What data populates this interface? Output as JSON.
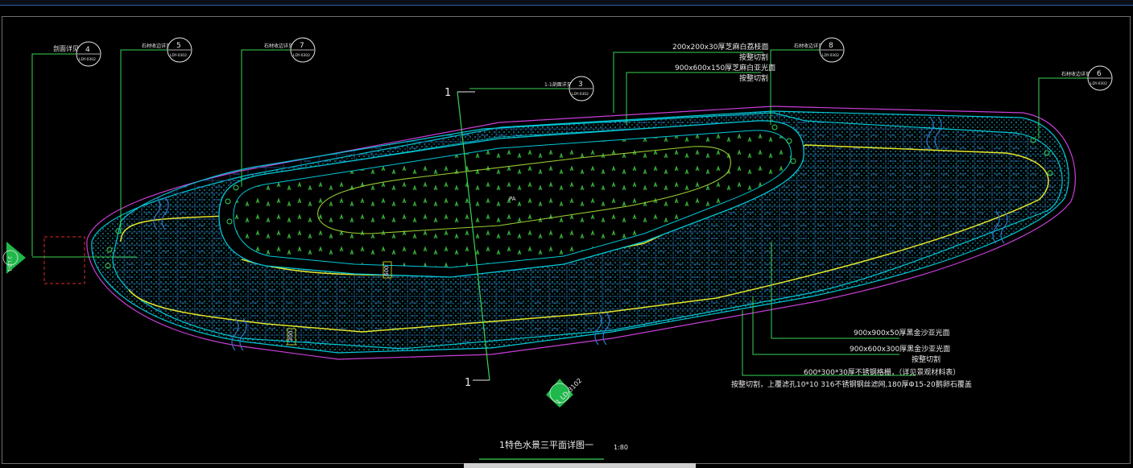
{
  "drawing": {
    "title": "1特色水景三平面详图一",
    "scale": "1:80",
    "area_label": "PA",
    "section_marker_top": "1",
    "section_marker_bottom": "1",
    "dim_600": "600",
    "dim_300": "300",
    "left_symbol": "2\nLD-1",
    "bottom_symbol": "1\nLD-3102"
  },
  "callouts": [
    {
      "id": "c4",
      "text": "剖面详见",
      "num": "4",
      "ref": "LDY-0302"
    },
    {
      "id": "c5",
      "text": "石材收边详见",
      "num": "5",
      "ref": "LDY-0302"
    },
    {
      "id": "c7",
      "text": "石材收边详见",
      "num": "7",
      "ref": "LDY-0302"
    },
    {
      "id": "c3",
      "text": "1-1剖面详见",
      "num": "3",
      "ref": "LDY-0302"
    },
    {
      "id": "c8",
      "text": "石材收边详见",
      "num": "8",
      "ref": "LDY-0302"
    },
    {
      "id": "c6",
      "text": "石材收边详见",
      "num": "6",
      "ref": "LDY-0302"
    }
  ],
  "notes_top": [
    "200x200x30厚芝麻白荔枝面",
    "按整切割",
    "900x600x150厚芝麻白亚光面",
    "按整切割"
  ],
  "notes_bottom": [
    "900x900x50厚黑金沙亚光面",
    "900x600x300厚黑金沙亚光面",
    "按整切割",
    "600*300*30厚不锈钢格栅，（详见景观材料表）",
    "按整切割，上覆滤孔10*10  316不锈钢钢丝滤网,180厚Φ15-20鹅卵石覆盖"
  ],
  "colors": {
    "cyan": "#00c8d8",
    "green": "#39d353",
    "yellow": "#e5e52a",
    "magenta": "#c83fd8",
    "red": "#e02a2a",
    "white": "#e8e8e8",
    "grid": "#1e4a7a"
  }
}
